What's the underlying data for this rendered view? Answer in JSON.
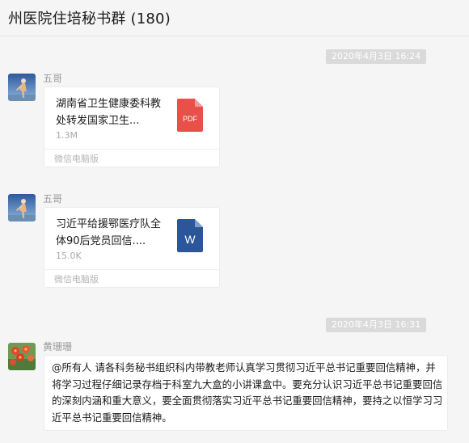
{
  "header": {
    "title": "州医院住培秘书群 (180)"
  },
  "timestamps": [
    "2020年4月3日 16:24",
    "2020年4月3日 16:31"
  ],
  "messages": [
    {
      "sender": "五哥",
      "file": {
        "name": "湖南省卫生健康委科教处转发国家卫生...",
        "size": "1.3M",
        "source": "微信电脑版",
        "type": "PDF",
        "icon_color": "#e9504a"
      }
    },
    {
      "sender": "五哥",
      "file": {
        "name": "习近平给援鄂医疗队全体90后党员回信....",
        "size": "15.0K",
        "source": "微信电脑版",
        "type": "W",
        "icon_color": "#2b579a"
      }
    },
    {
      "sender": "黄珊珊",
      "text": "@所有人 请各科务秘书组织科内带教老师认真学习贯彻习近平总书记重要回信精神，并将学习过程仔细记录存档于科室九大盒的小讲课盒中。要充分认识习近平总书记重要回信的深刻内涵和重大意义，要全面贯彻落实习近平总书记重要回信精神，要持之以恒学习习近平总书记重要回信精神。"
    }
  ],
  "colors": {
    "background": "#f5f5f5",
    "pill": "#dadada",
    "bubble": "#ffffff"
  }
}
